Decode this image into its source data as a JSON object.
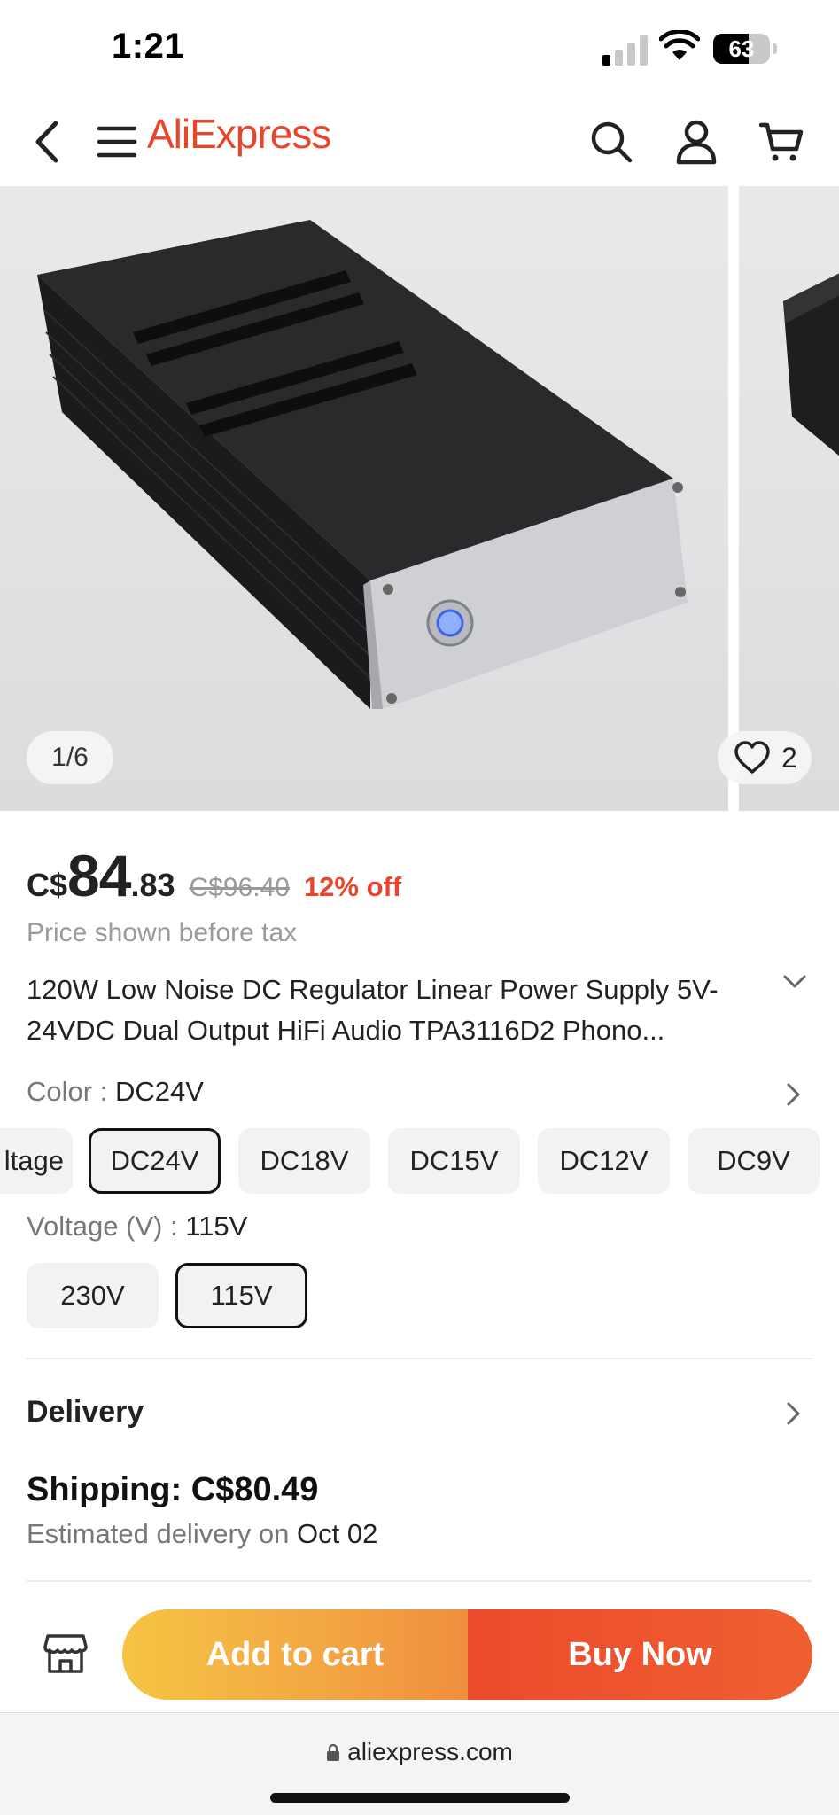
{
  "status_bar": {
    "time": "1:21",
    "battery": "63"
  },
  "header": {
    "logo": "AliExpress"
  },
  "gallery": {
    "counter": "1/6",
    "wishlist_count": "2"
  },
  "price": {
    "currency": "C$",
    "integer": "84",
    "decimal": ".83",
    "original": "C$96.40",
    "discount": "12% off",
    "note": "Price shown before tax"
  },
  "product": {
    "title": "120W Low Noise DC Regulator Linear Power Supply 5V-24VDC Dual Output HiFi Audio TPA3116D2 Phono..."
  },
  "color_option": {
    "label": "Color",
    "selected": "DC24V",
    "chips": [
      "ltage",
      "DC24V",
      "DC18V",
      "DC15V",
      "DC12V",
      "DC9V"
    ]
  },
  "voltage_option": {
    "label": "Voltage (V)",
    "selected": "115V",
    "chips": [
      "230V",
      "115V"
    ]
  },
  "delivery": {
    "heading": "Delivery",
    "shipping": "Shipping: C$80.49",
    "eta_prefix": "Estimated delivery on",
    "eta_date": "Oct 02"
  },
  "actions": {
    "add_to_cart": "Add to cart",
    "buy_now": "Buy Now"
  },
  "browser": {
    "url": "aliexpress.com"
  },
  "colors": {
    "accent": "#e8452b",
    "cart_gradient_start": "#f6c443",
    "buy_color": "#ec4a2c"
  }
}
